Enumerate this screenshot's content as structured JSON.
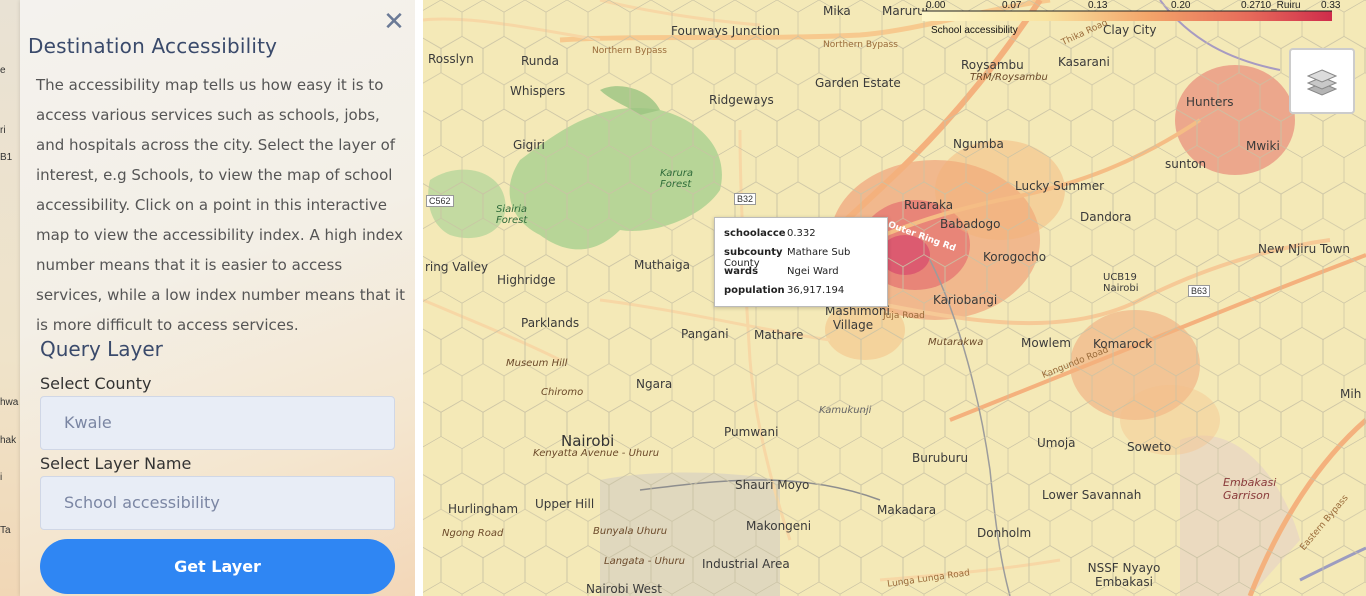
{
  "left_strip_labels": [
    "e",
    "B1",
    "ri",
    "hwa",
    "hak",
    "Ta",
    "i"
  ],
  "panel": {
    "title": "Destination Accessibility",
    "description": "The accessibility map tells us how easy it is to access various services such as schools, jobs, and hospitals across the city. Select the layer of interest, e.g Schools, to view the map of school accessibility. Click on a point in this interactive map to view the accessibility index. A high index number means that it is easier to access services, while a low index number means that it is more difficult to access services.",
    "query_title": "Query Layer",
    "county_label": "Select County",
    "county_value": "Kwale",
    "layer_label": "Select Layer Name",
    "layer_value": "School accessibility",
    "button_label": "Get Layer"
  },
  "legend": {
    "ticks": [
      "0.00",
      "0.07",
      "0.13",
      "0.20",
      "0.27",
      "10_Ruiru",
      "0.33"
    ],
    "title": "School accessibility",
    "colors": [
      "#fdf6c9",
      "#f9d38a",
      "#f3a56a",
      "#e66a5a",
      "#cf2c4b"
    ]
  },
  "popup": {
    "rows": [
      {
        "key": "schoolacce",
        "value": "0.332"
      },
      {
        "key": "subcounty",
        "value": "Mathare Sub County"
      },
      {
        "key": "wards",
        "value": "Ngei Ward"
      },
      {
        "key": "population",
        "value": "36,917.194"
      }
    ]
  },
  "map_labels": {
    "fourways": "Fourways Junction",
    "mika": "Mika",
    "marurui": "Marurui",
    "clay_city": "Clay City",
    "northern_bypass": "Northern Bypass",
    "northern_bypass2": "Northern Bypass",
    "rosslyn": "Rosslyn",
    "runda": "Runda",
    "garden_estate": "Garden Estate",
    "roysambu": "Roysambu",
    "kasarani": "Kasarani",
    "whispers": "Whispers",
    "ridgeways": "Ridgeways",
    "hunters": "Hunters",
    "gigiri": "Gigiri",
    "ngumba": "Ngumba",
    "mwiki": "Mwiki",
    "sunton": "sunton",
    "karura": "Karura Forest",
    "lucky_summer": "Lucky Summer",
    "siairia": "Siairia Forest",
    "ruaraka": "Ruaraka",
    "dandora": "Dandora",
    "babadogo": "Babadogo",
    "new_njiru": "New Njiru Town",
    "muthaiga": "Muthaiga",
    "korogocho": "Korogocho",
    "ring_valley": "ring Valley",
    "highridge": "Highridge",
    "ucb": "UCB19 Nairobi",
    "kariobangi": "Kariobangi",
    "parklands": "Parklands",
    "mashimoni": "Mashimoni Village",
    "pangani": "Pangani",
    "mathare": "Mathare",
    "mowlem": "Mowlem",
    "komarock": "Komarock",
    "museum_hill": "Museum Hill",
    "mutarakwa": "Mutarakwa",
    "ngara": "Ngara",
    "chiromo": "Chiromo",
    "kamukunji": "Kamukunji",
    "nairobi": "Nairobi",
    "pumwani": "Pumwani",
    "umoja": "Umoja",
    "soweto": "Soweto",
    "kenyatta_ave": "Kenyatta Avenue - Uhuru",
    "buruburu": "Buruburu",
    "shauri_moyo": "Shauri Moyo",
    "hurlingham": "Hurlingham",
    "upper_hill": "Upper Hill",
    "makadara": "Makadara",
    "lower_savannah": "Lower Savannah",
    "embakasi_garrison": "Embakasi Garrison",
    "makongeni": "Makongeni",
    "donholm": "Donholm",
    "bunyala": "Bunyala Uhuru",
    "ngong_road": "Ngong Road",
    "industrial": "Industrial Area",
    "nssf": "NSSF Nyayo Embakasi",
    "nairobi_west": "Nairobi West",
    "langata": "Langata - Uhuru",
    "thika_road": "Thika Road",
    "outer_ring": "Outer Ring Rd",
    "juja_road": "Juja Road",
    "kangundo": "Kangundo Road",
    "eastern_bypass": "Eastern Bypass",
    "lunga_lunga": "Lunga Lunga Road",
    "c562": "C562",
    "b32": "B32",
    "b63": "B63",
    "trm": "TRM/Roysambu",
    "right_edge": "Mih"
  }
}
